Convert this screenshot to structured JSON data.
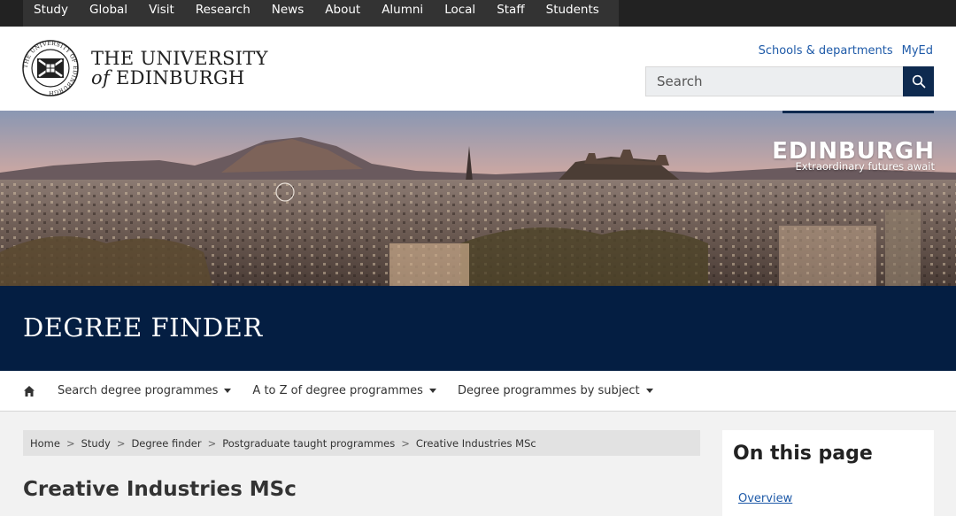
{
  "topnav": {
    "items": [
      "Study",
      "Global",
      "Visit",
      "Research",
      "News",
      "About",
      "Alumni",
      "Local",
      "Staff",
      "Students"
    ]
  },
  "header": {
    "crest_text": "THE UNIVERSITY OF EDINBURGH",
    "name_line1": "THE UNIVERSITY",
    "name_of": "of",
    "name_line2": "EDINBURGH",
    "links": [
      "Schools & departments",
      "MyEd"
    ],
    "search_placeholder": "Search"
  },
  "banner": {
    "brand_big": "EDINBURGH",
    "brand_small": "Extraordinary futures await"
  },
  "degree_finder": {
    "title": "DEGREE FINDER"
  },
  "subnav": {
    "items": [
      "Search degree programmes",
      "A to Z of degree programmes",
      "Degree programmes by subject"
    ]
  },
  "breadcrumb": [
    "Home",
    "Study",
    "Degree finder",
    "Postgraduate taught programmes",
    "Creative Industries MSc"
  ],
  "page": {
    "title": "Creative Industries MSc"
  },
  "on_this_page": {
    "heading": "On this page",
    "first_link": "Overview"
  },
  "colors": {
    "navy": "#041e42",
    "link": "#1e5aa8",
    "topnav": "#333333"
  }
}
